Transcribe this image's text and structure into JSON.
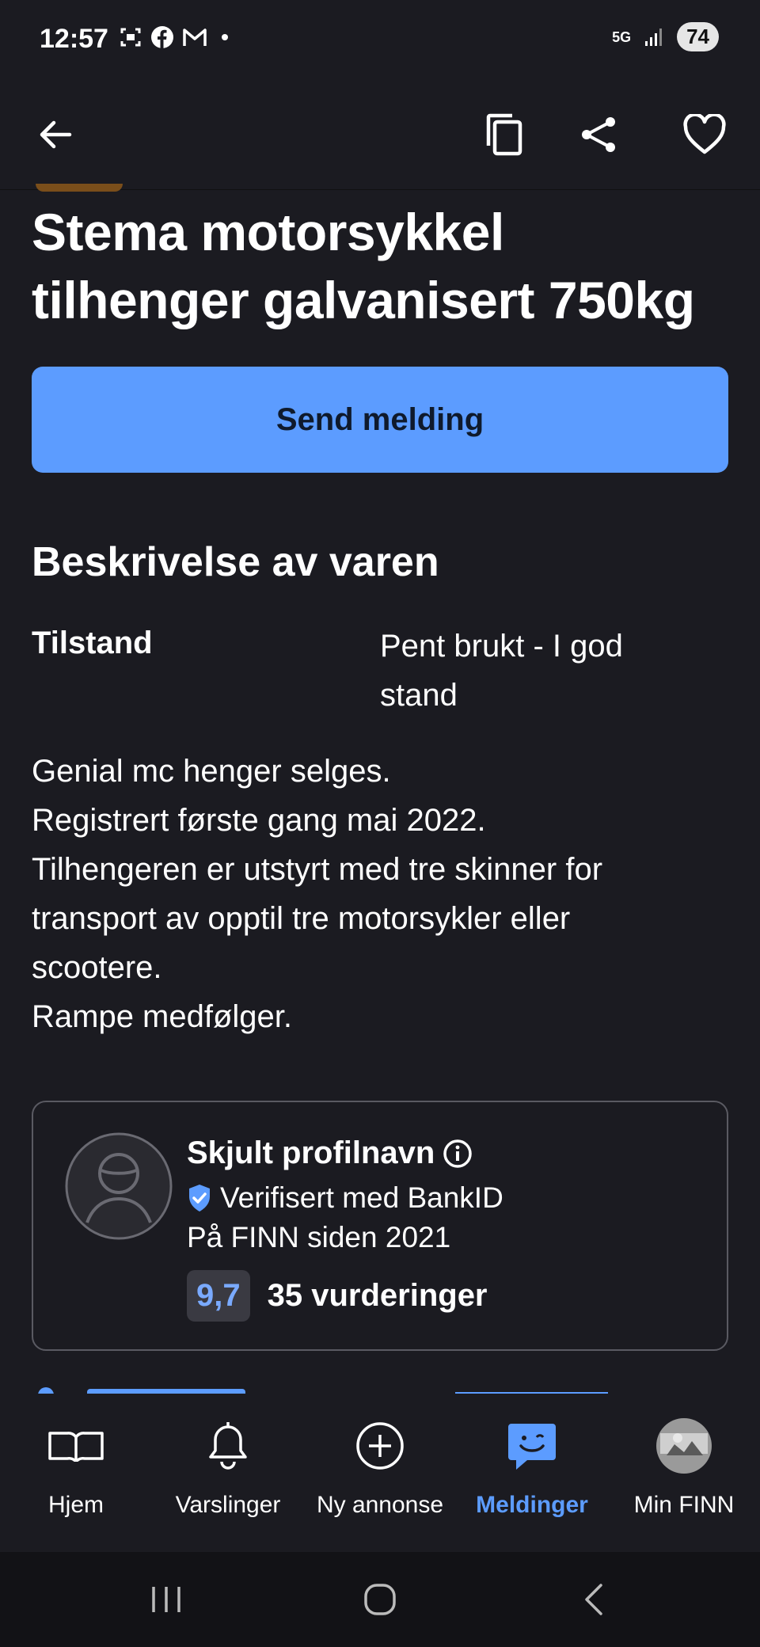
{
  "status": {
    "time": "12:57",
    "network": "5G",
    "battery": "74"
  },
  "listing": {
    "title_line1": "Stema motorsykkel",
    "title_line2": "tilhenger galvanisert 750kg",
    "send_button": "Send melding",
    "section_title": "Beskrivelse av varen",
    "condition_label": "Tilstand",
    "condition_value": "Pent brukt - I god stand",
    "description": [
      "Genial mc henger selges.",
      "Registrert første gang mai 2022.",
      "Tilhengeren er utstyrt med tre skinner for",
      "transport av opptil tre motorsykler eller",
      "scootere.",
      "Rampe medfølger."
    ]
  },
  "seller": {
    "name": "Skjult profilnavn",
    "verified": "Verifisert med BankID",
    "since": "På FINN siden 2021",
    "rating_score": "9,7",
    "rating_count": "35 vurderinger"
  },
  "nav": {
    "items": [
      {
        "label": "Hjem",
        "icon": "book-icon"
      },
      {
        "label": "Varslinger",
        "icon": "bell-icon"
      },
      {
        "label": "Ny annonse",
        "icon": "plus-circle-icon"
      },
      {
        "label": "Meldinger",
        "icon": "chat-icon",
        "active": true
      },
      {
        "label": "Min FINN",
        "icon": "avatar"
      }
    ]
  },
  "colors": {
    "background": "#1b1b21",
    "accent": "#5c9cff",
    "verified": "#5c9cff"
  }
}
